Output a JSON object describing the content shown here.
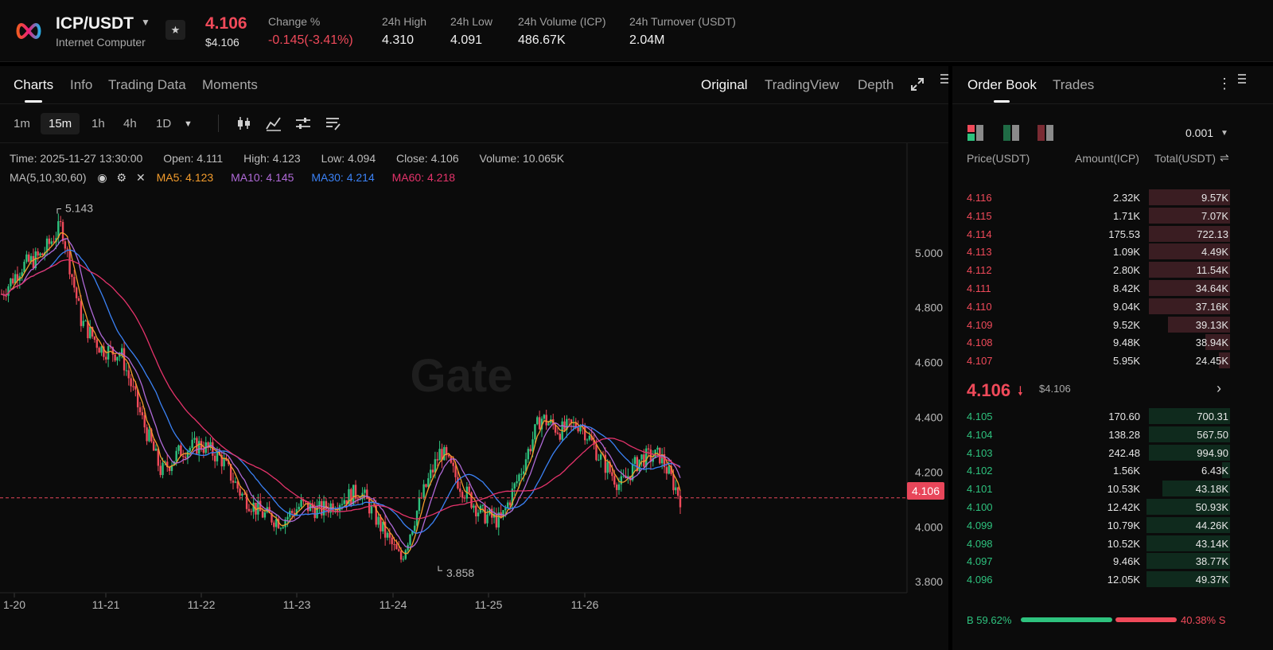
{
  "header": {
    "pair": "ICP/USDT",
    "pair_name": "Internet Computer",
    "last_price": "4.106",
    "last_price_usd": "$4.106",
    "stats": [
      {
        "label": "Change %",
        "value": "-0.145(-3.41%)",
        "color": "#f04a5a"
      },
      {
        "label": "24h High",
        "value": "4.310"
      },
      {
        "label": "24h Low",
        "value": "4.091"
      },
      {
        "label": "24h Volume (ICP)",
        "value": "486.67K"
      },
      {
        "label": "24h Turnover (USDT)",
        "value": "2.04M"
      }
    ]
  },
  "chart_tabs": [
    "Charts",
    "Info",
    "Trading Data",
    "Moments"
  ],
  "view_tabs": [
    "Original",
    "TradingView",
    "Depth"
  ],
  "timeframes": [
    "1m",
    "15m",
    "1h",
    "4h",
    "1D"
  ],
  "active_timeframe": "15m",
  "info": {
    "time": "Time: 2025-11-27 13:30:00",
    "open": "Open: 4.111",
    "high": "High: 4.123",
    "low": "Low: 4.094",
    "close": "Close: 4.106",
    "volume": "Volume: 10.065K"
  },
  "ma": {
    "label": "MA(5,10,30,60)",
    "ma5": "MA5: 4.123",
    "ma10": "MA10: 4.145",
    "ma30": "MA30: 4.214",
    "ma60": "MA60: 4.218"
  },
  "chart_data": {
    "type": "line",
    "series": [
      {
        "name": "ICP/USDT 15m",
        "x": [
          "11-20",
          "11-20",
          "11-20",
          "11-20",
          "11-21",
          "11-21",
          "11-21",
          "11-21",
          "11-21",
          "11-22",
          "11-22",
          "11-22",
          "11-22",
          "11-23",
          "11-23",
          "11-23",
          "11-23",
          "11-24",
          "11-24",
          "11-24",
          "11-24",
          "11-24",
          "11-25",
          "11-25",
          "11-25",
          "11-25",
          "11-25",
          "11-25",
          "11-26",
          "11-26",
          "11-26",
          "11-26",
          "11-26",
          "11-26",
          "11-27"
        ],
        "values": [
          4.85,
          4.95,
          4.99,
          5.1,
          4.75,
          4.65,
          4.63,
          4.4,
          4.2,
          4.28,
          4.3,
          4.25,
          4.12,
          4.05,
          4.02,
          4.08,
          4.06,
          4.1,
          4.13,
          4.0,
          3.88,
          4.1,
          4.28,
          4.15,
          4.05,
          4.02,
          4.2,
          4.4,
          4.35,
          4.38,
          4.25,
          4.15,
          4.25,
          4.26,
          4.106
        ]
      }
    ],
    "annotations": [
      {
        "text": "5.143",
        "x": "11-20",
        "y": 5.143
      },
      {
        "text": "3.858",
        "x": "11-24",
        "y": 3.858
      }
    ],
    "x_ticks": [
      "1-20",
      "11-21",
      "11-22",
      "11-23",
      "11-24",
      "11-25",
      "11-26"
    ],
    "y_ticks": [
      "5.000",
      "4.800",
      "4.600",
      "4.400",
      "4.200",
      "4.000",
      "3.800"
    ],
    "ylim": [
      3.76,
      5.4
    ],
    "current_price": "4.106",
    "colors": {
      "up": "#2ec27e",
      "down": "#f04a5a",
      "ma5": "#f39c2c",
      "ma10": "#b06ad8",
      "ma30": "#3b82f6",
      "ma60": "#e5336b"
    }
  },
  "order_book": {
    "tabs": [
      "Order Book",
      "Trades"
    ],
    "precision": "0.001",
    "headers": [
      "Price(USDT)",
      "Amount(ICP)",
      "Total(USDT)"
    ],
    "asks": [
      {
        "price": "4.116",
        "amount": "2.32K",
        "total": "9.57K",
        "depth": 0.3
      },
      {
        "price": "4.115",
        "amount": "1.71K",
        "total": "7.07K",
        "depth": 0.3
      },
      {
        "price": "4.114",
        "amount": "175.53",
        "total": "722.13",
        "depth": 0.3
      },
      {
        "price": "4.113",
        "amount": "1.09K",
        "total": "4.49K",
        "depth": 0.3
      },
      {
        "price": "4.112",
        "amount": "2.80K",
        "total": "11.54K",
        "depth": 0.3
      },
      {
        "price": "4.111",
        "amount": "8.42K",
        "total": "34.64K",
        "depth": 0.3
      },
      {
        "price": "4.110",
        "amount": "9.04K",
        "total": "37.16K",
        "depth": 0.3
      },
      {
        "price": "4.109",
        "amount": "9.52K",
        "total": "39.13K",
        "depth": 0.23
      },
      {
        "price": "4.108",
        "amount": "9.48K",
        "total": "38.94K",
        "depth": 0.09
      },
      {
        "price": "4.107",
        "amount": "5.95K",
        "total": "24.45K",
        "depth": 0.04
      }
    ],
    "mid_price": "4.106",
    "mid_usd": "$4.106",
    "bids": [
      {
        "price": "4.105",
        "amount": "170.60",
        "total": "700.31",
        "depth": 0.3
      },
      {
        "price": "4.104",
        "amount": "138.28",
        "total": "567.50",
        "depth": 0.3
      },
      {
        "price": "4.103",
        "amount": "242.48",
        "total": "994.90",
        "depth": 0.3
      },
      {
        "price": "4.102",
        "amount": "1.56K",
        "total": "6.43K",
        "depth": 0.03
      },
      {
        "price": "4.101",
        "amount": "10.53K",
        "total": "43.18K",
        "depth": 0.25
      },
      {
        "price": "4.100",
        "amount": "12.42K",
        "total": "50.93K",
        "depth": 0.31
      },
      {
        "price": "4.099",
        "amount": "10.79K",
        "total": "44.26K",
        "depth": 0.31
      },
      {
        "price": "4.098",
        "amount": "10.52K",
        "total": "43.14K",
        "depth": 0.31
      },
      {
        "price": "4.097",
        "amount": "9.46K",
        "total": "38.77K",
        "depth": 0.31
      },
      {
        "price": "4.096",
        "amount": "12.05K",
        "total": "49.37K",
        "depth": 0.31
      }
    ],
    "buy_label": "B",
    "buy_pct": "59.62%",
    "sell_label": "S",
    "sell_pct": "40.38%",
    "buy_fraction": 0.5962
  },
  "watermark": "Gate"
}
